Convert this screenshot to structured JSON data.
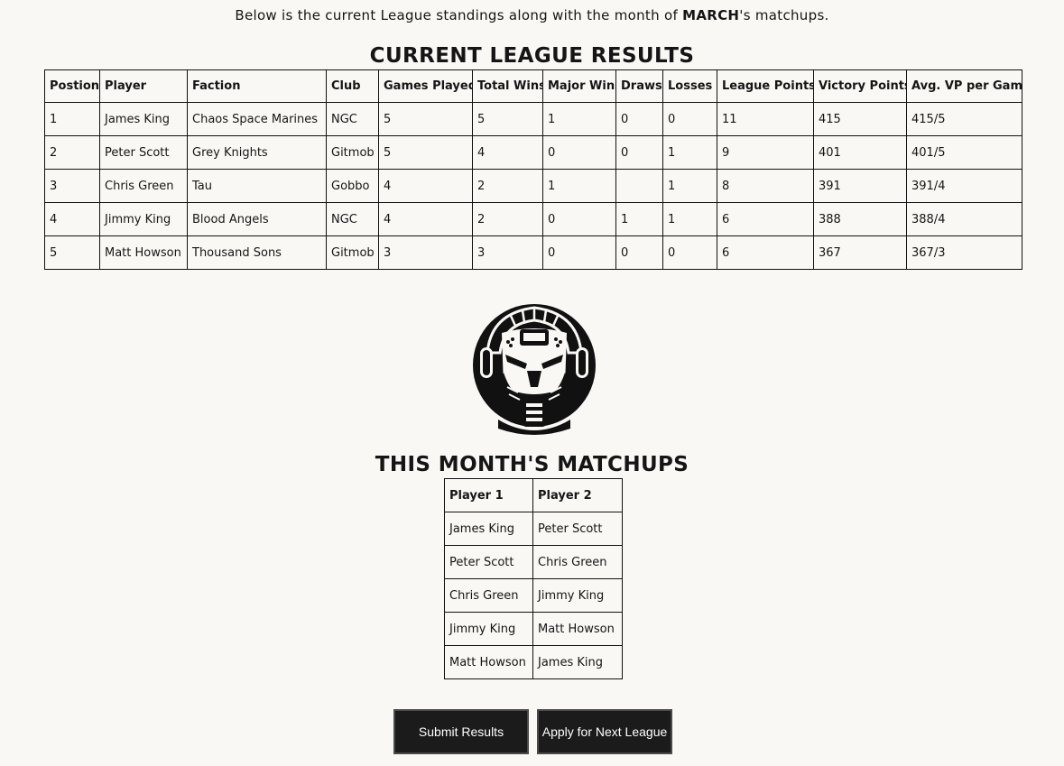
{
  "intro": {
    "before": "Below is the current League standings along with the month of ",
    "month": "MARCH",
    "after": "'s matchups."
  },
  "league": {
    "title": "CURRENT LEAGUE RESULTS",
    "headers": [
      "Postion",
      "Player",
      "Faction",
      "Club",
      "Games Played",
      "Total Wins",
      "Major Wins",
      "Draws",
      "Losses",
      "League Points",
      "Victory Points",
      "Avg. VP per Game"
    ],
    "rows": [
      [
        "1",
        "James King",
        "Chaos Space Marines",
        "NGC",
        "5",
        "5",
        "1",
        "0",
        "0",
        "11",
        "415",
        "415/5"
      ],
      [
        "2",
        "Peter Scott",
        "Grey Knights",
        "Gitmob",
        "5",
        "4",
        "0",
        "0",
        "1",
        "9",
        "401",
        "401/5"
      ],
      [
        "3",
        "Chris Green",
        "Tau",
        "Gobbo",
        "4",
        "2",
        "1",
        "",
        "1",
        "8",
        "391",
        "391/4"
      ],
      [
        "4",
        "Jimmy King",
        "Blood Angels",
        "NGC",
        "4",
        "2",
        "0",
        "1",
        "1",
        "6",
        "388",
        "388/4"
      ],
      [
        "5",
        "Matt Howson",
        "Thousand Sons",
        "Gitmob",
        "3",
        "3",
        "0",
        "0",
        "0",
        "6",
        "367",
        "367/3"
      ]
    ]
  },
  "logo": {
    "icon": "helmet-logo-icon"
  },
  "matchups": {
    "title": "THIS MONTH'S MATCHUPS",
    "headers": [
      "Player 1",
      "Player 2"
    ],
    "rows": [
      [
        "James King",
        "Peter Scott"
      ],
      [
        "Peter Scott",
        "Chris Green"
      ],
      [
        "Chris Green",
        "Jimmy King"
      ],
      [
        "Jimmy King",
        "Matt Howson"
      ],
      [
        "Matt Howson",
        "James King"
      ]
    ]
  },
  "buttons": {
    "submit": "Submit Results",
    "apply": "Apply for Next League"
  }
}
